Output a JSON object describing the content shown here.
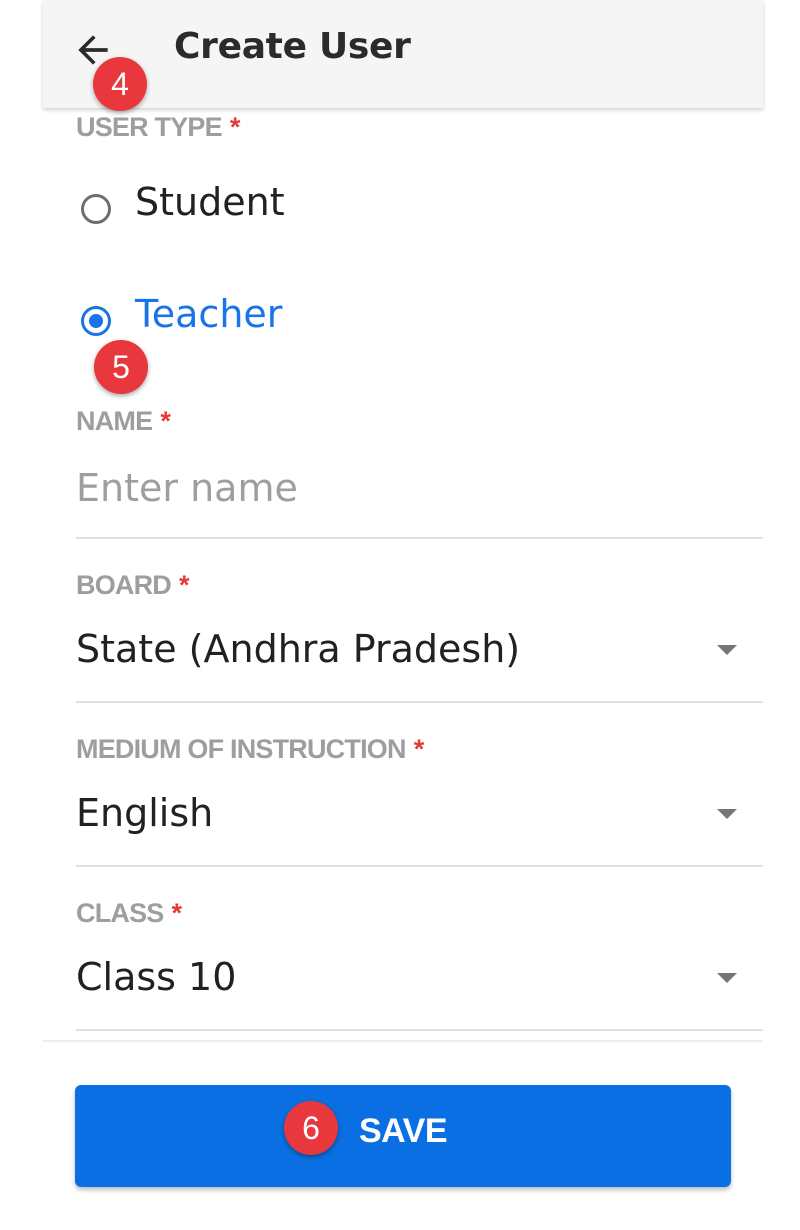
{
  "app_bar": {
    "title": "Create User",
    "back_icon": "arrow-back-icon"
  },
  "step_badges": {
    "back": "4",
    "teacher": "5",
    "save": "6"
  },
  "user_type": {
    "label": "USER TYPE",
    "required_mark": "*",
    "options": [
      {
        "label": "Student",
        "selected": false
      },
      {
        "label": "Teacher",
        "selected": true
      }
    ]
  },
  "name": {
    "label": "NAME",
    "required_mark": "*",
    "value": "",
    "placeholder": "Enter name"
  },
  "board": {
    "label": "BOARD",
    "required_mark": "*",
    "value": "State (Andhra Pradesh)"
  },
  "medium": {
    "label": "MEDIUM OF INSTRUCTION",
    "required_mark": "*",
    "value": "English"
  },
  "class": {
    "label": "CLASS",
    "required_mark": "*",
    "value": "Class 10"
  },
  "footer": {
    "save_label": "SAVE"
  },
  "colors": {
    "accent": "#1a73e8",
    "button": "#0a6fe2",
    "required": "#e53935",
    "badge": "#e8383d",
    "label": "#9e9e9e"
  }
}
